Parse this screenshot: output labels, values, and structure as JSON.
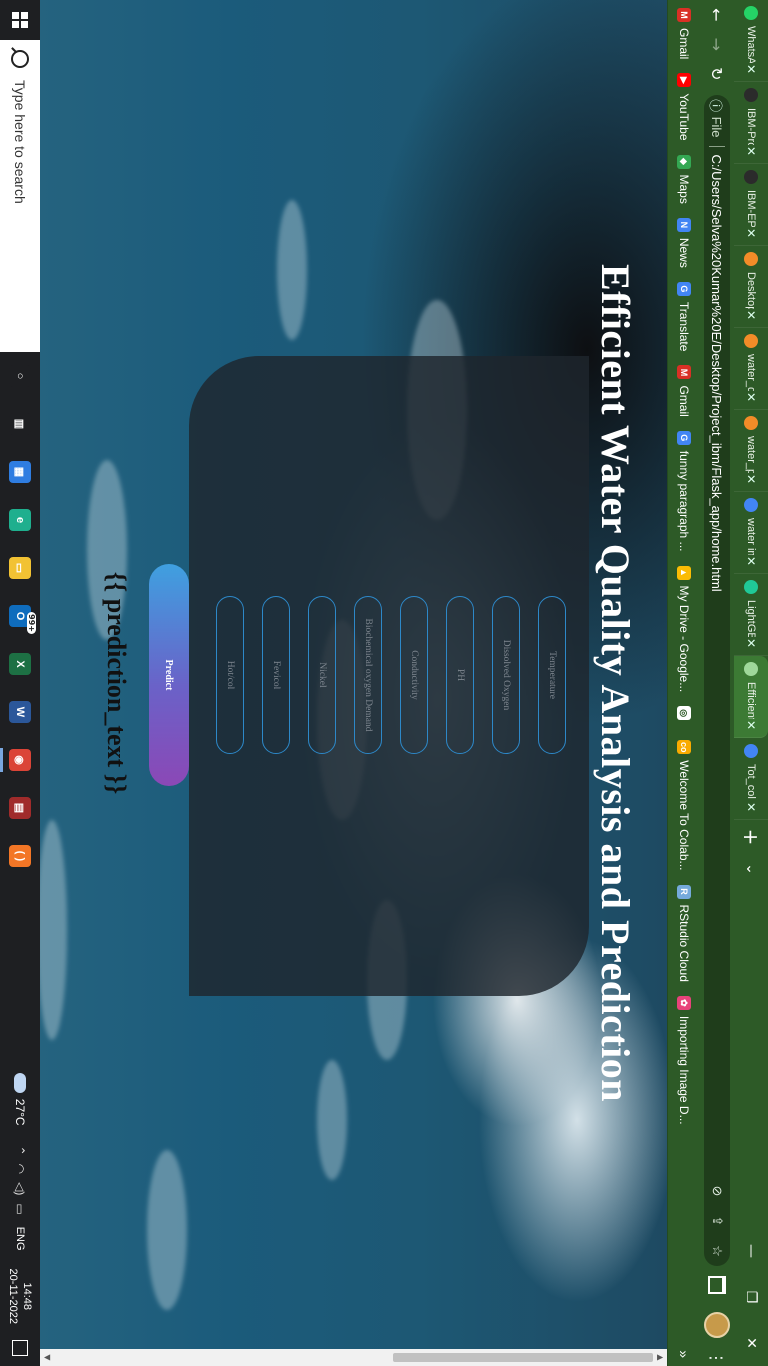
{
  "browser": {
    "tabs": [
      {
        "title": "WhatsAp",
        "color": "#25d366"
      },
      {
        "title": "IBM-Pro",
        "color": "#2b2b2b"
      },
      {
        "title": "IBM-EPB",
        "color": "#2b2b2b"
      },
      {
        "title": "Desktop",
        "color": "#f28c28"
      },
      {
        "title": "water_d",
        "color": "#f28c28"
      },
      {
        "title": "water_p",
        "color": "#f28c28"
      },
      {
        "title": "water im",
        "color": "#4285f4"
      },
      {
        "title": "LightGB",
        "color": "#20c997"
      },
      {
        "title": "Efficient",
        "color": "#9fd89a",
        "active": true
      },
      {
        "title": "Tot_col",
        "color": "#4285f4"
      }
    ],
    "new_tab": "+",
    "url_scheme_label": "File",
    "url": "C:/Users/Selva%20Kumar%20E/Desktop/Project_ibm/Flask_app/home.html",
    "bookmarks": [
      {
        "label": "Gmail",
        "color": "#d93025",
        "glyph": "M"
      },
      {
        "label": "YouTube",
        "color": "#ff0000",
        "glyph": "▶"
      },
      {
        "label": "Maps",
        "color": "#34a853",
        "glyph": "◆"
      },
      {
        "label": "News",
        "color": "#4285f4",
        "glyph": "N"
      },
      {
        "label": "Translate",
        "color": "#4285f4",
        "glyph": "G"
      },
      {
        "label": "Gmail",
        "color": "#d93025",
        "glyph": "M"
      },
      {
        "label": "funny paragraph ...",
        "color": "#4285f4",
        "glyph": "G"
      },
      {
        "label": "My Drive - Google...",
        "color": "#fbbc04",
        "glyph": "▲"
      },
      {
        "label": "",
        "color": "#ffffff",
        "glyph": "◎"
      },
      {
        "label": "Welcome To Colab...",
        "color": "#f9ab00",
        "glyph": "co"
      },
      {
        "label": "RStudio Cloud",
        "color": "#75aadb",
        "glyph": "R"
      },
      {
        "label": "Importing Image D...",
        "color": "#e8437a",
        "glyph": "✿"
      }
    ],
    "bookmarks_more": "»"
  },
  "page": {
    "title": "Efficient Water Quality Analysis and Prediction",
    "fields": [
      {
        "placeholder": "Temperature"
      },
      {
        "placeholder": "Dissolved Oxygen"
      },
      {
        "placeholder": "PH"
      },
      {
        "placeholder": "Conductivity"
      },
      {
        "placeholder": "Biochemical oxygen Demand"
      },
      {
        "placeholder": "Nickel"
      },
      {
        "placeholder": "Fevicol"
      },
      {
        "placeholder": "Hot/col"
      }
    ],
    "predict_label": "Predict",
    "prediction_text": "{{ prediction_text }}"
  },
  "taskbar": {
    "search_placeholder": "Type here to search",
    "apps": [
      {
        "name": "task-view",
        "glyph": "○",
        "color": "#1e1f22"
      },
      {
        "name": "widgets",
        "glyph": "▥",
        "color": "#1e1f22"
      },
      {
        "name": "store",
        "glyph": "▦",
        "color": "#2f7de1"
      },
      {
        "name": "edge",
        "glyph": "e",
        "color": "#1faf8e"
      },
      {
        "name": "file-explorer",
        "glyph": "▭",
        "color": "#f2c233"
      },
      {
        "name": "outlook",
        "glyph": "O",
        "color": "#0f6cbd",
        "badge": "99+"
      },
      {
        "name": "excel",
        "glyph": "X",
        "color": "#1d7044"
      },
      {
        "name": "word",
        "glyph": "W",
        "color": "#2b579a"
      },
      {
        "name": "chrome",
        "glyph": "◉",
        "color": "#db4437",
        "active": true
      },
      {
        "name": "winrar",
        "glyph": "▤",
        "color": "#a02b2b"
      },
      {
        "name": "jupyter",
        "glyph": "( )",
        "color": "#f37626"
      }
    ],
    "temperature": "27°C",
    "language": "ENG",
    "time": "14:48",
    "date": "20-11-2022"
  },
  "colors": {
    "browser_chrome": "#2d5a27",
    "card_bg": "rgba(30,38,45,0.82)",
    "field_border": "#2d88c8",
    "predict_gradient_start": "#3fa0e0",
    "predict_gradient_end": "#8b48b6"
  }
}
